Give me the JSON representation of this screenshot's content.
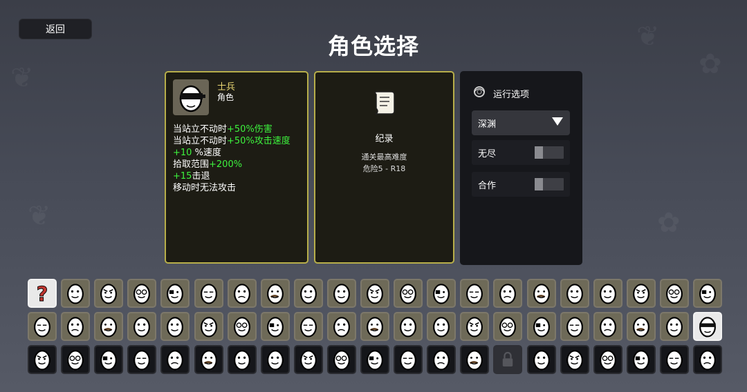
{
  "back_button": {
    "label": "返回"
  },
  "page_title": "角色选择",
  "character": {
    "name": "士兵",
    "subtitle": "角色",
    "stats": [
      {
        "prefix": "当站立不动时",
        "highlight": "+50%伤害",
        "suffix": ""
      },
      {
        "prefix": "当站立不动时",
        "highlight": "+50%攻击速度",
        "suffix": ""
      },
      {
        "prefix": "",
        "highlight": "+10",
        "suffix": " %速度"
      },
      {
        "prefix": "拾取范围",
        "highlight": "+200%",
        "suffix": ""
      },
      {
        "prefix": "",
        "highlight": "+15",
        "suffix": "击退"
      },
      {
        "prefix": "移动时无法攻击",
        "highlight": "",
        "suffix": ""
      }
    ]
  },
  "record": {
    "label": "纪录",
    "line1": "通关最高难度",
    "line2": "危险5 - R18"
  },
  "run_options": {
    "title": "运行选项",
    "difficulty_selected": "深渊",
    "toggles": [
      {
        "label": "无尽",
        "on": false
      },
      {
        "label": "合作",
        "on": false
      }
    ]
  },
  "colors": {
    "panel_border": "#b7ae4a",
    "highlight_green": "#3df23d",
    "name_yellow": "#ead773"
  },
  "character_grid": {
    "rows": 3,
    "columns": 21,
    "selected_cell": "row 2, col 21",
    "random_cell_icon": "question-mark-icon",
    "locked_cell_icon": "padlock-icon"
  }
}
